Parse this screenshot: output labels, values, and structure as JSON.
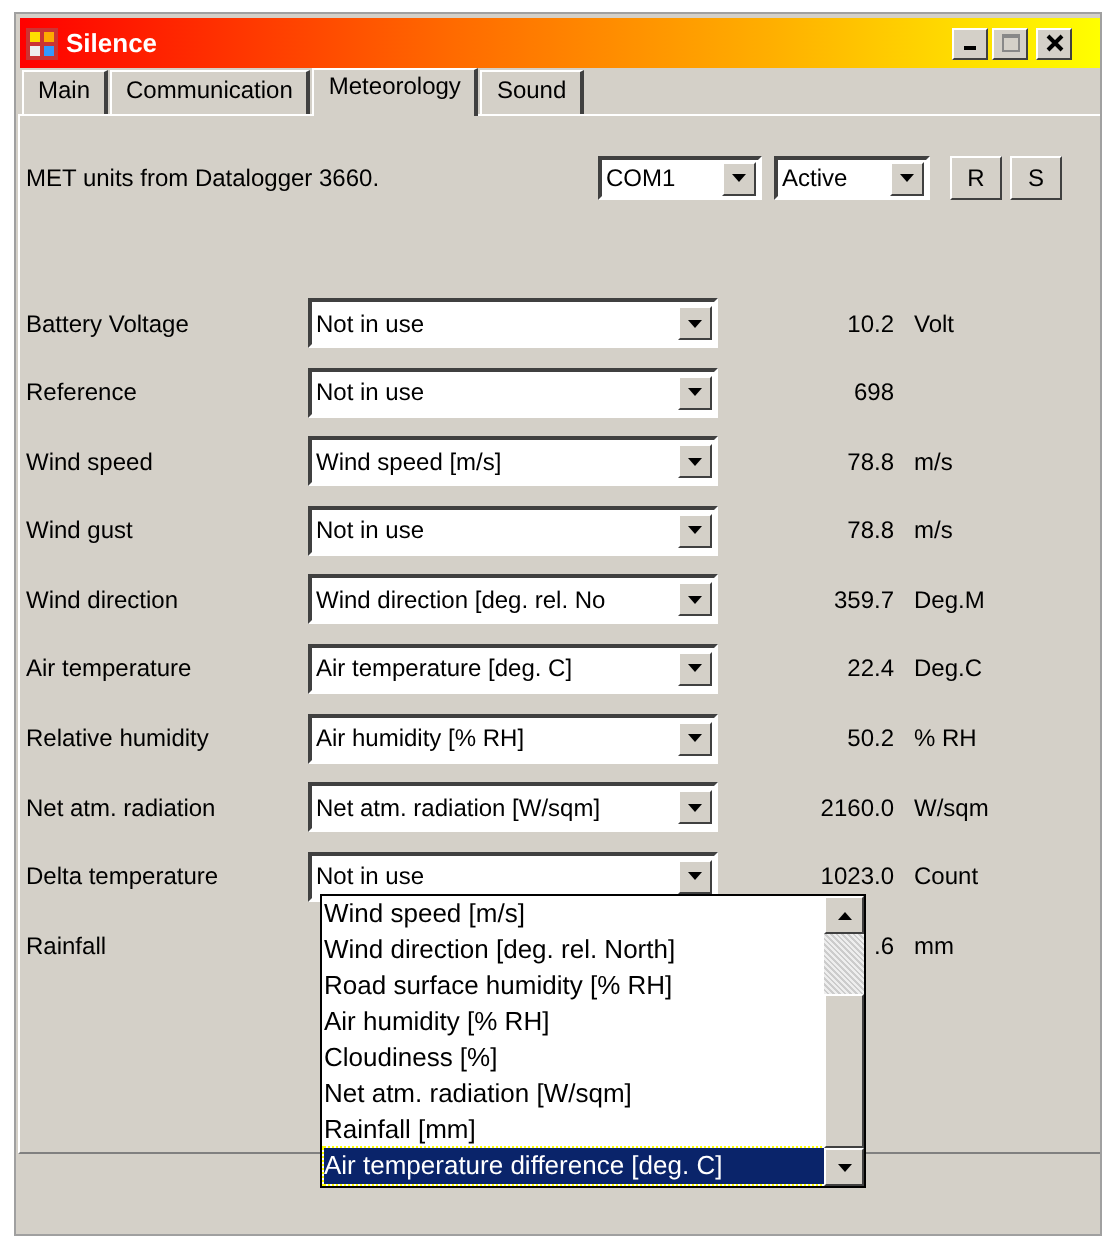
{
  "window": {
    "title": "Silence"
  },
  "tabs": [
    {
      "label": "Main",
      "selected": false
    },
    {
      "label": "Communication",
      "selected": false
    },
    {
      "label": "Meteorology",
      "selected": true
    },
    {
      "label": "Sound",
      "selected": false
    }
  ],
  "header": {
    "text": "MET units from Datalogger 3660.",
    "port": "COM1",
    "mode": "Active",
    "buttons": [
      "R",
      "S"
    ]
  },
  "rows": [
    {
      "label": "Battery Voltage",
      "source": "Not in use",
      "value": "10.2",
      "unit": "Volt"
    },
    {
      "label": "Reference",
      "source": "Not in use",
      "value": "698"
    },
    {
      "label": "Wind speed",
      "source": "Wind speed [m/s]",
      "value": "78.8",
      "unit": "m/s"
    },
    {
      "label": "Wind gust",
      "source": "Not in use",
      "value": "78.8",
      "unit": "m/s"
    },
    {
      "label": "Wind direction",
      "source": "Wind direction [deg. rel. No",
      "value": "359.7",
      "unit": "Deg.M"
    },
    {
      "label": "Air temperature",
      "source": "Air temperature [deg. C]",
      "value": "22.4",
      "unit": "Deg.C"
    },
    {
      "label": "Relative humidity",
      "source": "Air humidity [% RH]",
      "value": "50.2",
      "unit": "% RH"
    },
    {
      "label": "Net atm. radiation",
      "source": "Net atm. radiation [W/sqm]",
      "value": "2160.0",
      "unit": "W/sqm"
    },
    {
      "label": "Delta temperature",
      "source": "Not in use",
      "value": "1023.0",
      "unit": "Count"
    },
    {
      "label": "Rainfall",
      "value": ".6",
      "unit": "mm"
    }
  ],
  "dropdown_list": [
    {
      "label": "Wind speed [m/s]",
      "selected": false
    },
    {
      "label": "Wind direction [deg. rel. North]",
      "selected": false
    },
    {
      "label": "Road surface humidity [% RH]",
      "selected": false
    },
    {
      "label": "Air humidity [% RH]",
      "selected": false
    },
    {
      "label": "Cloudiness [%]",
      "selected": false
    },
    {
      "label": "Net atm. radiation [W/sqm]",
      "selected": false
    },
    {
      "label": "Rainfall [mm]",
      "selected": false
    },
    {
      "label": "Air temperature difference [deg. C]",
      "selected": true
    }
  ]
}
